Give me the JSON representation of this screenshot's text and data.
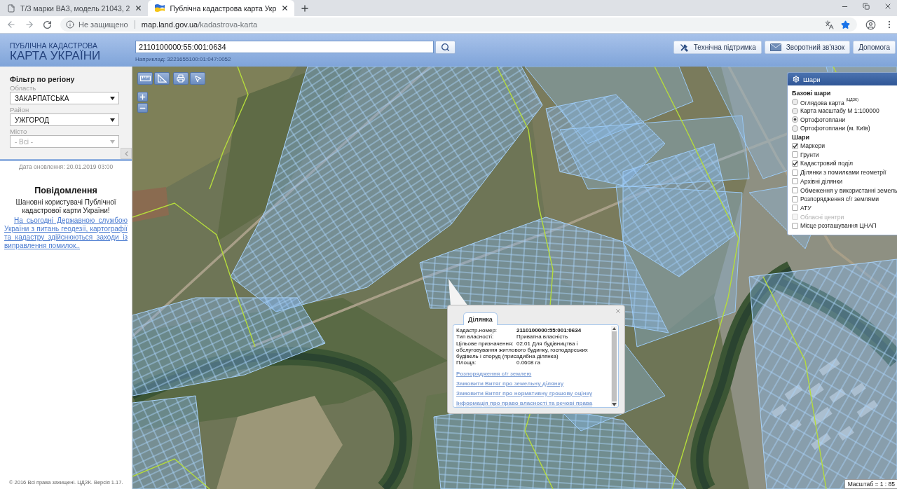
{
  "browser": {
    "tabs": [
      {
        "title": "Т/З марки ВАЗ, модель 21043, 2",
        "selected": false
      },
      {
        "title": "Публічна кадастрова карта Укр",
        "selected": true
      }
    ],
    "security_label": "Не защищено",
    "url": {
      "host": "map.land.gov.ua",
      "path": "/kadastrova-karta"
    }
  },
  "header": {
    "logo": {
      "line_1": "ПУБЛІЧНА КАДАСТРОВА",
      "line_2": "КАРТА УКРАЇНИ"
    },
    "search": {
      "value": "2110100000:55:001:0634",
      "example": "Наприклад: 3221655100:01:047:0052"
    },
    "buttons": [
      {
        "kind": "support",
        "label": "Технічна підтримка"
      },
      {
        "kind": "feedback",
        "label": "Зворотний зв'язок"
      },
      {
        "kind": "help",
        "label": "Допомога"
      }
    ]
  },
  "sidebar": {
    "filter": {
      "title": "Фільтр по регіону",
      "fields": [
        {
          "label": "Область",
          "value": "ЗАКАРПАТСЬКА",
          "disabled": false
        },
        {
          "label": "Район",
          "value": "УЖГОРОД",
          "disabled": false
        },
        {
          "label": "Місто",
          "value": "- Всі -",
          "disabled": true
        }
      ]
    },
    "update_date": "Дата оновлення: 20.01.2019 03:00",
    "notice": {
      "title": "Повідомлення",
      "greeting": "Шановні користувачі Публічної кадастрової карти України!",
      "link": "На сьогодні Державною службою України з питань геодезії, картографії та кадастру здійснюються заходи із виправлення помилок.."
    },
    "footer": "© 2016 Всі права захищені. ЦДЗК. Версія 1.17."
  },
  "map": {
    "layers": {
      "title": "Шари",
      "base_title": "Базові шари",
      "base_layers": [
        {
          "label": "Оглядова карта $^{(ЦДЗК)}$",
          "selected": false
        },
        {
          "label": "Карта масштабу М 1:100000",
          "selected": false
        },
        {
          "label": "Ортофотоплани",
          "selected": true
        },
        {
          "label": "Ортофотоплани (м. Київ)",
          "selected": false
        }
      ],
      "overlay_title": "Шари",
      "overlays": [
        {
          "label": "Маркери",
          "checked": true,
          "disabled": false
        },
        {
          "label": "Грунти",
          "checked": false,
          "disabled": false
        },
        {
          "label": "Кадастровий поділ",
          "checked": true,
          "disabled": false
        },
        {
          "label": "Ділянки з помилками геометрії",
          "checked": false,
          "disabled": false
        },
        {
          "label": "Архівні ділянки",
          "checked": false,
          "disabled": false
        },
        {
          "label": "Обмеження у використанні земель",
          "checked": false,
          "disabled": false
        },
        {
          "label": "Розпорядження с/г землями",
          "checked": false,
          "disabled": false
        },
        {
          "label": "АТУ",
          "checked": false,
          "disabled": false
        },
        {
          "label": "Обласні центри",
          "checked": false,
          "disabled": true
        },
        {
          "label": "Місце розташування ЦНАП",
          "checked": false,
          "disabled": false
        }
      ]
    },
    "popup": {
      "tab": "Ділянка",
      "fields": [
        {
          "label": "Кадастр.номер:",
          "value": "2110100000:55:001:0634",
          "strong": true
        },
        {
          "label": "Тип власності:",
          "value": "Приватна власність",
          "strong": false
        },
        {
          "label": "Цільове призначення:",
          "value": "02.01 Для будівництва і обслуговування житлового будинку, господарських будівель і споруд (присадибна ділянка)",
          "strong": false
        },
        {
          "label": "Площа:",
          "value": "0.0608 га",
          "strong": false
        }
      ],
      "links": [
        "Розпорядження с/г землею",
        "Замовити Витяг про земельну ділянку",
        "Замовити Витяг про нормативну грошову оцінку",
        "Інформація про право власності та речові права"
      ]
    },
    "scale": "Масштаб = 1 : 85"
  }
}
